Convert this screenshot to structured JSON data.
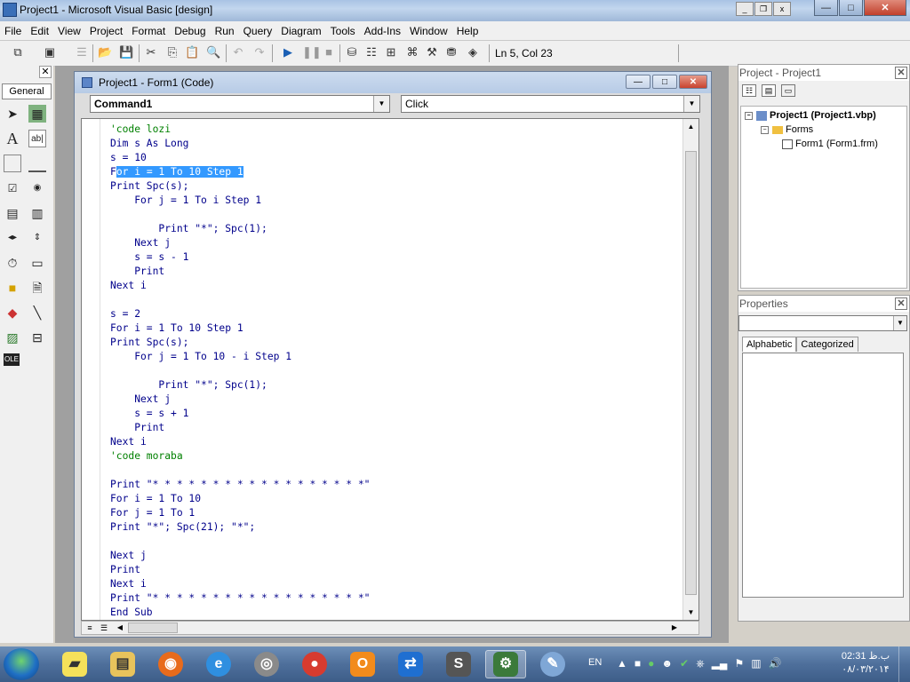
{
  "window": {
    "title": "Project1 - Microsoft Visual Basic [design]",
    "controls": [
      "—",
      "□",
      "✕"
    ]
  },
  "menu": [
    "File",
    "Edit",
    "View",
    "Project",
    "Format",
    "Debug",
    "Run",
    "Query",
    "Diagram",
    "Tools",
    "Add-Ins",
    "Window",
    "Help"
  ],
  "toolbar": {
    "status": "Ln 5, Col 23"
  },
  "toolbox": {
    "tab": "General",
    "close": "✕",
    "tools": [
      "pointer",
      "picturebox",
      "label",
      "textbox",
      "frame",
      "commandbutton",
      "checkbox",
      "optionbutton",
      "combobox",
      "listbox",
      "hscrollbar",
      "vscrollbar",
      "timer",
      "drivelistbox",
      "dirlistbox",
      "filelistbox",
      "shape",
      "line",
      "image",
      "data",
      "ole"
    ]
  },
  "code_window": {
    "title": "Project1 - Form1 (Code)",
    "object_combo": "Command1",
    "procedure_combo": "Click",
    "lines": [
      {
        "t": "'code lozi",
        "c": "comment"
      },
      {
        "t": "Dim s As Long",
        "c": "kw"
      },
      {
        "t": "s = 10",
        "c": "plain"
      },
      {
        "t": "For i = 1 To 10 Step 1",
        "c": "kw",
        "highlight": true
      },
      {
        "t": "Print Spc(s);",
        "c": "kw"
      },
      {
        "t": "    For j = 1 To i Step 1",
        "c": "kw"
      },
      {
        "t": "",
        "c": "plain"
      },
      {
        "t": "        Print \"*\"; Spc(1);",
        "c": "kw"
      },
      {
        "t": "    Next j",
        "c": "kw"
      },
      {
        "t": "    s = s - 1",
        "c": "plain"
      },
      {
        "t": "    Print",
        "c": "kw"
      },
      {
        "t": "Next i",
        "c": "kw"
      },
      {
        "t": "",
        "c": "plain"
      },
      {
        "t": "s = 2",
        "c": "plain"
      },
      {
        "t": "For i = 1 To 10 Step 1",
        "c": "kw"
      },
      {
        "t": "Print Spc(s);",
        "c": "kw"
      },
      {
        "t": "    For j = 1 To 10 - i Step 1",
        "c": "kw"
      },
      {
        "t": "",
        "c": "plain"
      },
      {
        "t": "        Print \"*\"; Spc(1);",
        "c": "kw"
      },
      {
        "t": "    Next j",
        "c": "kw"
      },
      {
        "t": "    s = s + 1",
        "c": "plain"
      },
      {
        "t": "    Print",
        "c": "kw"
      },
      {
        "t": "Next i",
        "c": "kw"
      },
      {
        "t": "'code moraba",
        "c": "comment"
      },
      {
        "t": "",
        "c": "plain"
      },
      {
        "t": "Print \"* * * * * * * * * * * * * * * * * *\"",
        "c": "kw"
      },
      {
        "t": "For i = 1 To 10",
        "c": "kw"
      },
      {
        "t": "For j = 1 To 1",
        "c": "kw"
      },
      {
        "t": "Print \"*\"; Spc(21); \"*\";",
        "c": "kw"
      },
      {
        "t": "",
        "c": "plain"
      },
      {
        "t": "Next j",
        "c": "kw"
      },
      {
        "t": "Print",
        "c": "kw"
      },
      {
        "t": "Next i",
        "c": "kw"
      },
      {
        "t": "Print \"* * * * * * * * * * * * * * * * * *\"",
        "c": "kw"
      },
      {
        "t": "End Sub",
        "c": "kw"
      }
    ]
  },
  "project_explorer": {
    "title": "Project - Project1",
    "root": "Project1 (Project1.vbp)",
    "folder": "Forms",
    "item": "Form1 (Form1.frm)"
  },
  "properties": {
    "title": "Properties",
    "tabs": [
      "Alphabetic",
      "Categorized"
    ]
  },
  "taskbar": {
    "language": "EN",
    "time": "02:31 ب.ظ",
    "date": "۰۸/۰۳/۲۰۱۴"
  },
  "colors": {
    "comment": "#008000",
    "keyword": "#00008b",
    "selection": "#3399ff"
  }
}
